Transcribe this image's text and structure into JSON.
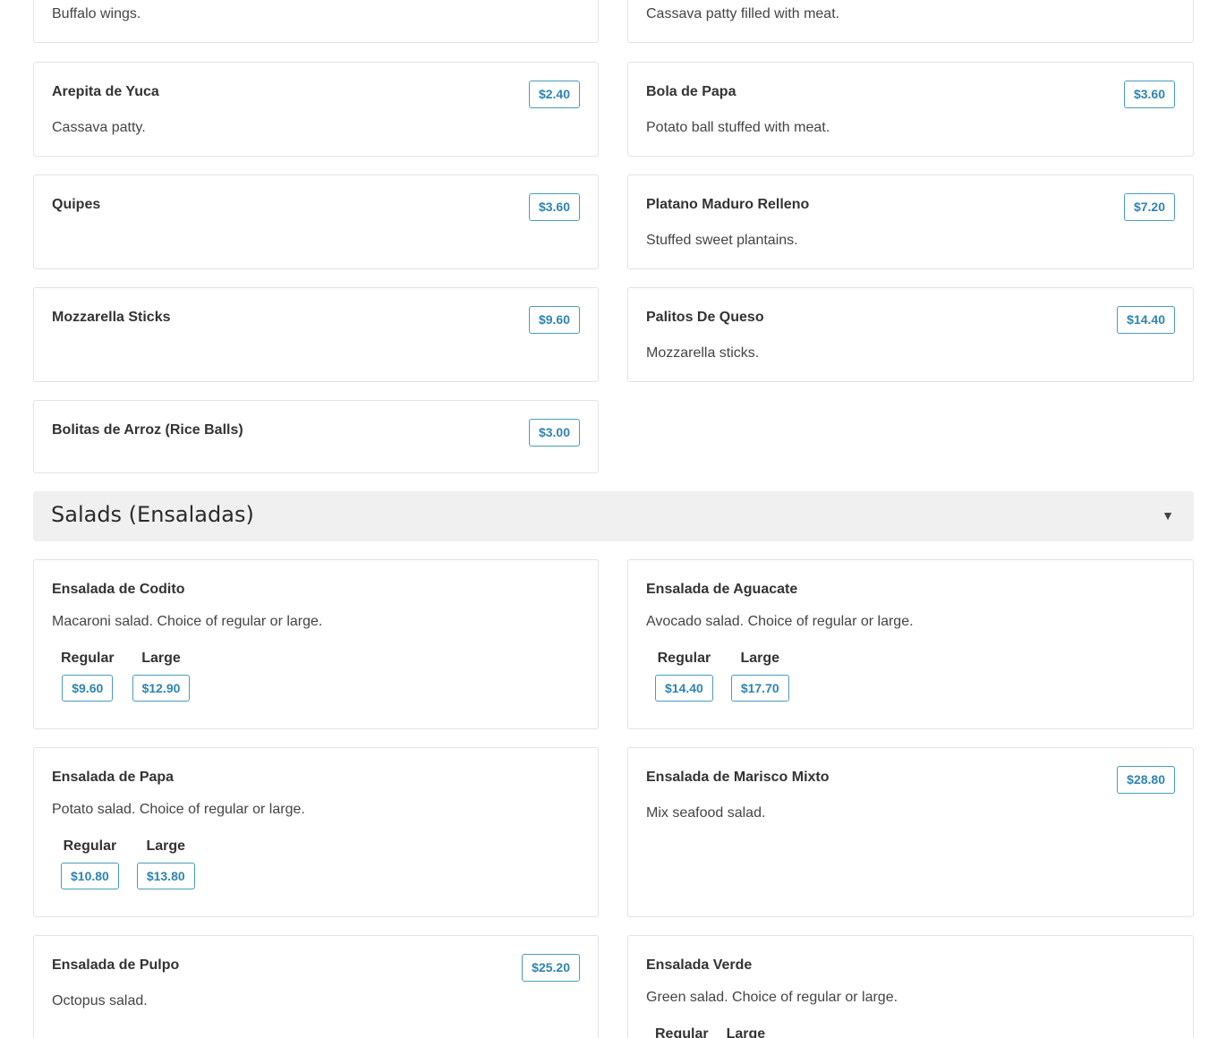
{
  "appetizers": {
    "top_partial_left": {
      "desc": "Buffalo wings."
    },
    "top_partial_right": {
      "desc": "Cassava patty filled with meat."
    },
    "items": [
      {
        "name": "Arepita de Yuca",
        "price": "$2.40",
        "desc": "Cassava patty."
      },
      {
        "name": "Bola de Papa",
        "price": "$3.60",
        "desc": "Potato ball stuffed with meat."
      },
      {
        "name": "Quipes",
        "price": "$3.60",
        "desc": ""
      },
      {
        "name": "Platano Maduro Relleno",
        "price": "$7.20",
        "desc": "Stuffed sweet plantains."
      },
      {
        "name": "Mozzarella Sticks",
        "price": "$9.60",
        "desc": ""
      },
      {
        "name": "Palitos De Queso",
        "price": "$14.40",
        "desc": "Mozzarella sticks."
      },
      {
        "name": "Bolitas de Arroz (Rice Balls)",
        "price": "$3.00",
        "desc": ""
      }
    ]
  },
  "salads": {
    "title": "Salads (Ensaladas)",
    "caret": "▼",
    "size_labels": {
      "regular": "Regular",
      "large": "Large"
    },
    "items": [
      {
        "name": "Ensalada de Codito",
        "desc": "Macaroni salad. Choice of regular or large.",
        "regular": "$9.60",
        "large": "$12.90"
      },
      {
        "name": "Ensalada de Aguacate",
        "desc": "Avocado salad. Choice of regular or large.",
        "regular": "$14.40",
        "large": "$17.70"
      },
      {
        "name": "Ensalada de Papa",
        "desc": "Potato salad. Choice of regular or large.",
        "regular": "$10.80",
        "large": "$13.80"
      },
      {
        "name": "Ensalada de Marisco Mixto",
        "desc": "Mix seafood salad.",
        "price": "$28.80"
      },
      {
        "name": "Ensalada de Pulpo",
        "desc": "Octopus salad.",
        "price": "$25.20"
      },
      {
        "name": "Ensalada Verde",
        "desc": "Green salad. Choice of regular or large."
      }
    ]
  }
}
